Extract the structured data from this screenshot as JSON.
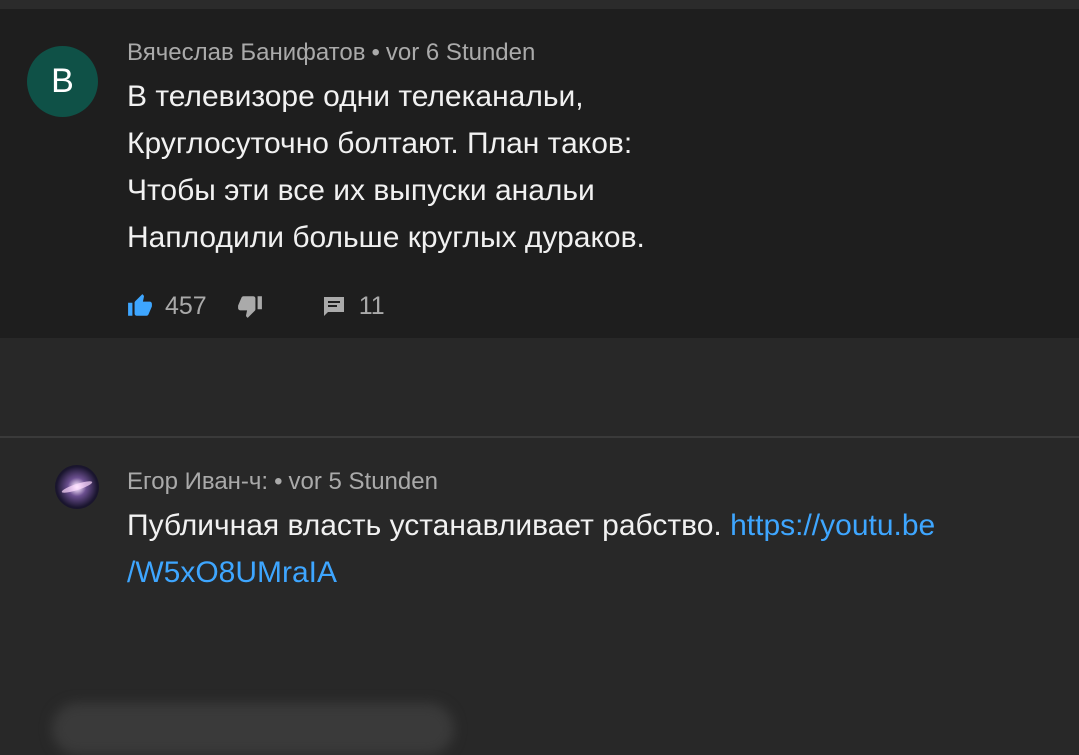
{
  "comments": [
    {
      "avatar_letter": "B",
      "author": "Вячеслав Банифатов",
      "separator": "•",
      "time": "vor 6 Stunden",
      "lines": [
        "В телевизоре одни  телеканальи,",
        "Круглосуточно болтают. План таков:",
        "Чтобы эти все их выпуски анальи",
        "Наплодили больше круглых дураков."
      ],
      "likes": "457",
      "replies": "11",
      "like_icon": "thumb-up-icon",
      "dislike_icon": "thumb-down-icon",
      "reply_icon": "comment-icon",
      "like_color": "#3ea6ff"
    },
    {
      "author": "Егор Иван-ч:",
      "separator": "•",
      "time": "vor 5 Stunden",
      "text": "Публичная власть устанавливает рабство.",
      "link_line1": "https://youtu.be",
      "link_line2": "/W5xO8UMraIA",
      "link_color": "#3ea6ff"
    }
  ]
}
